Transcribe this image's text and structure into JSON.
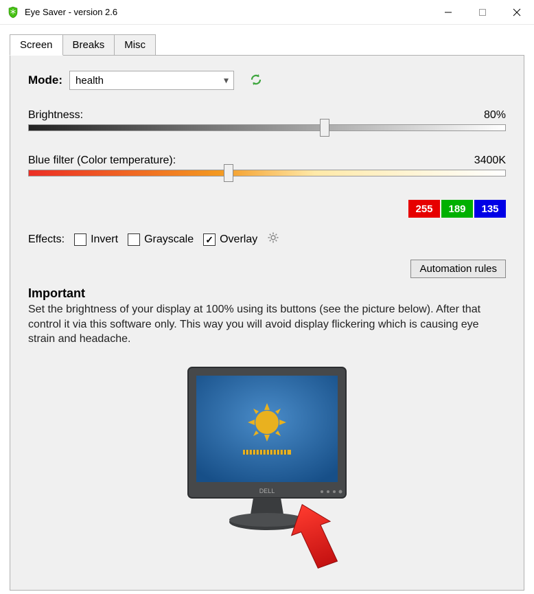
{
  "window": {
    "title": "Eye Saver - version 2.6"
  },
  "tabs": [
    {
      "label": "Screen",
      "active": true
    },
    {
      "label": "Breaks",
      "active": false
    },
    {
      "label": "Misc",
      "active": false
    }
  ],
  "mode": {
    "label": "Mode:",
    "selected": "health"
  },
  "brightness": {
    "label": "Brightness:",
    "value_text": "80%",
    "percent": 62
  },
  "blue_filter": {
    "label": "Blue filter (Color temperature):",
    "value_text": "3400K",
    "percent": 42
  },
  "rgb": {
    "r": "255",
    "g": "189",
    "b": "135"
  },
  "effects": {
    "label": "Effects:",
    "invert": {
      "label": "Invert",
      "checked": false
    },
    "grayscale": {
      "label": "Grayscale",
      "checked": false
    },
    "overlay": {
      "label": "Overlay",
      "checked": true
    }
  },
  "automation_button": "Automation rules",
  "important": {
    "heading": "Important",
    "text": "Set the brightness of your display at 100% using its buttons (see the picture below). After that control it via this software only. This way you will avoid display flickering which is causing eye strain and headache."
  },
  "monitor_brand": "DELL"
}
